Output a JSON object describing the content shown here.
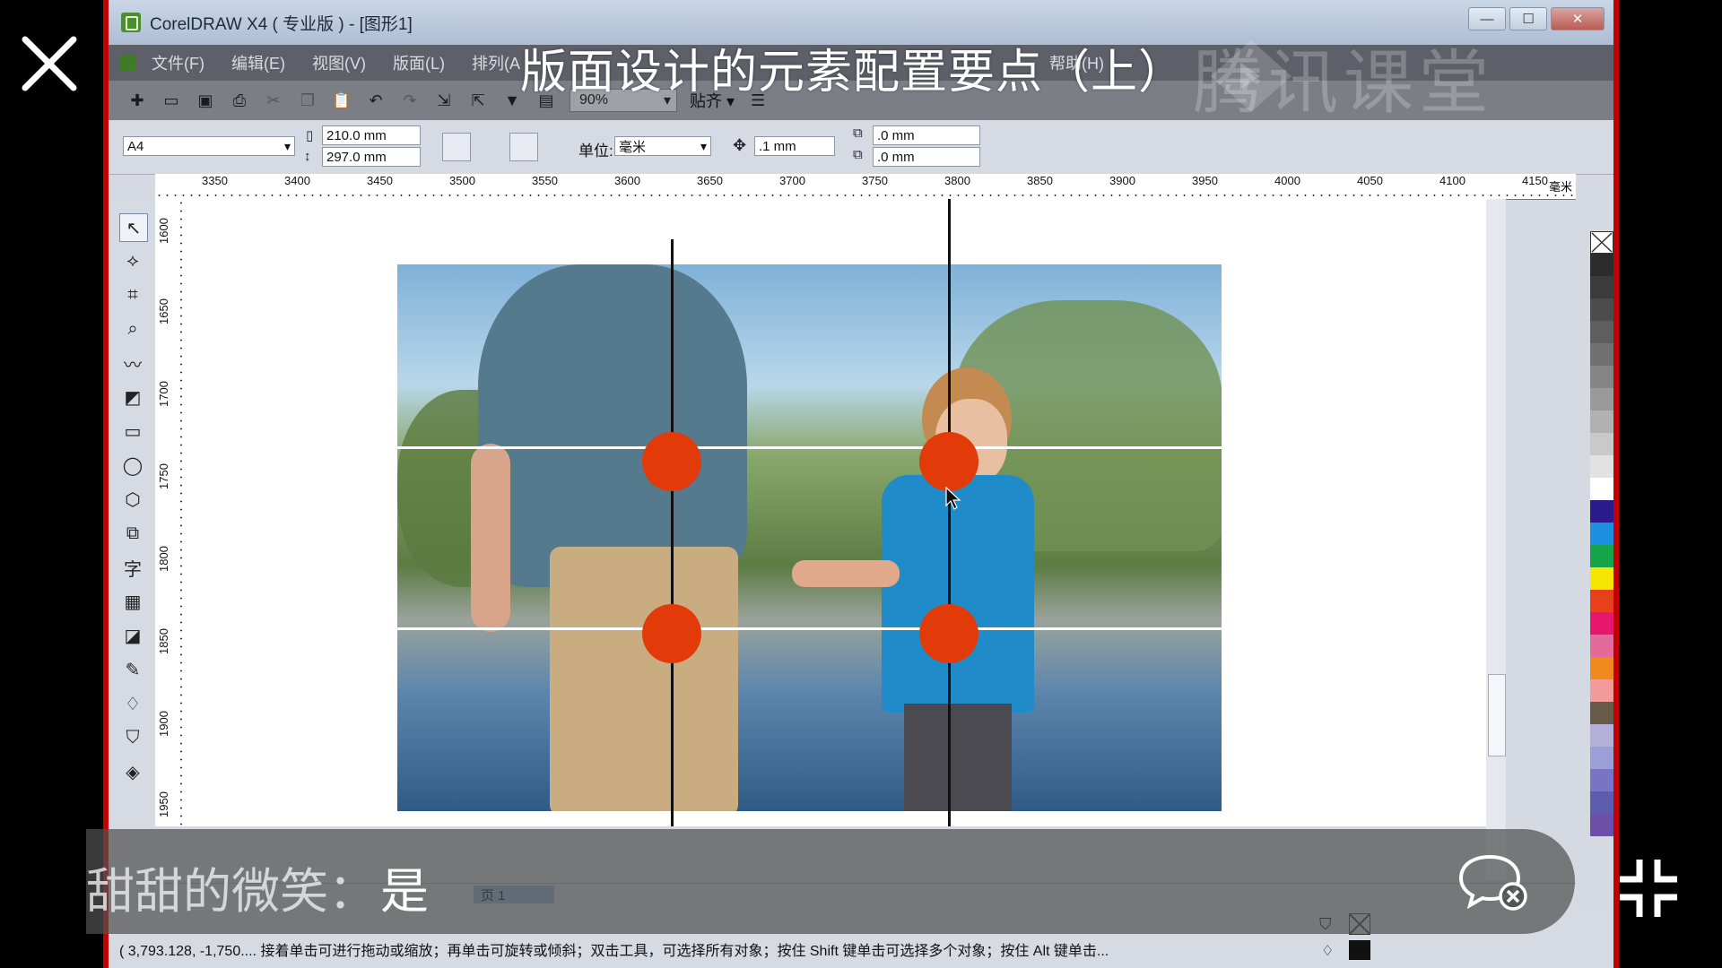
{
  "window": {
    "title": "CorelDRAW X4 ( 专业版 ) - [图形1]",
    "buttons": [
      "—",
      "☐",
      "✕"
    ]
  },
  "menu": [
    "文件(F)",
    "编辑(E)",
    "视图(V)",
    "版面(L)",
    "排列(A",
    "帮助(H)"
  ],
  "toolbar": {
    "zoom": "90%",
    "snap_label": "贴齐"
  },
  "property_bar": {
    "paper_size": "A4",
    "width": "210.0 mm",
    "height": "297.0 mm",
    "unit_label": "单位:",
    "unit_value": "毫米",
    "nudge": ".1 mm",
    "dup_x": ".0 mm",
    "dup_y": ".0 mm"
  },
  "ruler": {
    "h_ticks": [
      "3350",
      "3400",
      "3450",
      "3500",
      "3550",
      "3600",
      "3650",
      "3700",
      "3750",
      "3800",
      "3850",
      "3900",
      "3950",
      "4000",
      "4050",
      "4100",
      "4150"
    ],
    "unit": "毫米",
    "v_ticks": [
      "1600",
      "1650",
      "1700",
      "1750",
      "1800",
      "1850",
      "1900",
      "1950"
    ]
  },
  "page_tab": "页 1",
  "status_text": "( 3,793.128, -1,750.... 接着单击可进行拖动或缩放；再单击可旋转或倾斜；双击工具，可选择所有对象；按住 Shift 键单击可选择多个对象；按住 Alt 键单击...",
  "palette": [
    "#2c2c2c",
    "#3b3b3b",
    "#4c4c4c",
    "#5e5e5e",
    "#717171",
    "#858585",
    "#9a9a9a",
    "#b1b1b1",
    "#c9c9c9",
    "#e2e2e2",
    "#ffffff",
    "#2a1a8c",
    "#1e8fe0",
    "#17a34a",
    "#f5e600",
    "#e8401a",
    "#e8176e",
    "#e46a9a",
    "#f08a1c",
    "#f39a9a",
    "#6a5a4a",
    "#b5b0d8",
    "#9a9fd8",
    "#7a74c4",
    "#5c5cb0",
    "#6c4fa8"
  ],
  "overlay": {
    "video_title": "版面设计的元素配置要点（上）",
    "watermark": "腾讯课堂",
    "chat_user": "甜甜的微笑：",
    "chat_message": "是"
  }
}
